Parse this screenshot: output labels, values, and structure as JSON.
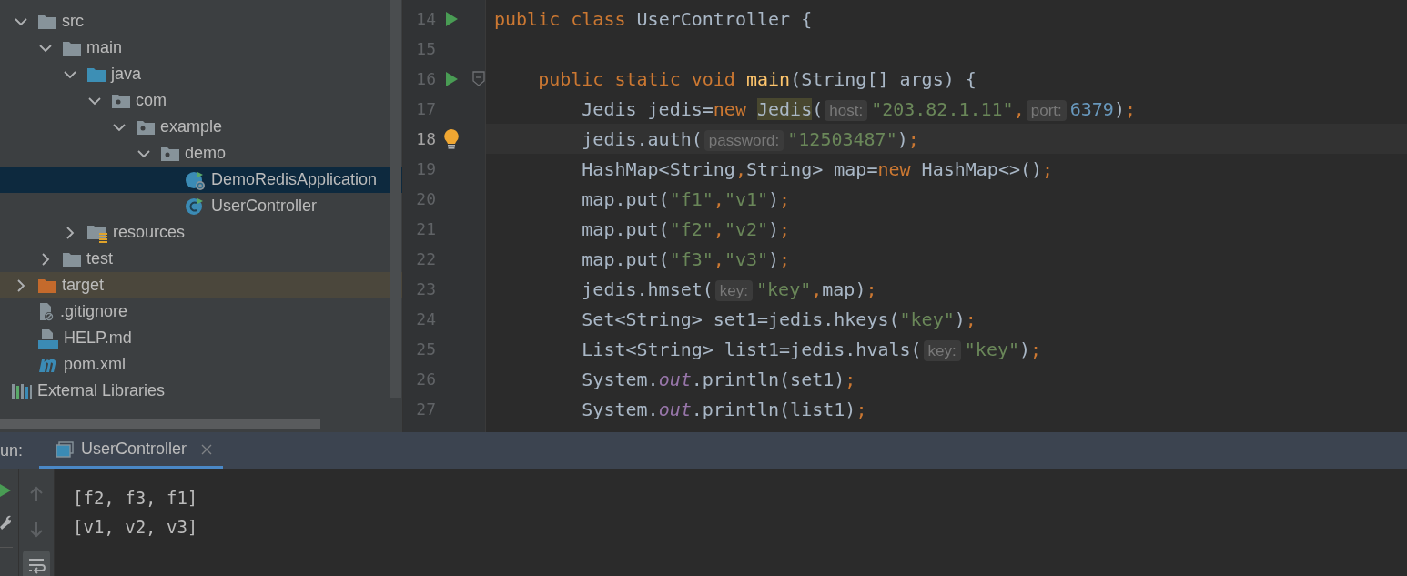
{
  "project_tree": {
    "items": [
      {
        "label": "src",
        "kind": "folder",
        "expanded": true,
        "selected": false,
        "excluded": false,
        "children": [
          {
            "label": "main",
            "kind": "folder",
            "expanded": true,
            "selected": false,
            "excluded": false,
            "children": [
              {
                "label": "java",
                "kind": "source-folder",
                "expanded": true,
                "selected": false,
                "excluded": false,
                "children": [
                  {
                    "label": "com",
                    "kind": "package",
                    "expanded": true,
                    "selected": false,
                    "excluded": false,
                    "children": [
                      {
                        "label": "example",
                        "kind": "package",
                        "expanded": true,
                        "selected": false,
                        "excluded": false,
                        "children": [
                          {
                            "label": "demo",
                            "kind": "package",
                            "expanded": true,
                            "selected": false,
                            "excluded": false,
                            "children": [
                              {
                                "label": "DemoRedisApplication",
                                "kind": "boot-class",
                                "selected": true,
                                "excluded": false
                              },
                              {
                                "label": "UserController",
                                "kind": "class",
                                "selected": false,
                                "excluded": false
                              }
                            ]
                          }
                        ]
                      }
                    ]
                  }
                ]
              },
              {
                "label": "resources",
                "kind": "resources-folder",
                "expanded": false,
                "selected": false,
                "excluded": false
              }
            ]
          },
          {
            "label": "test",
            "kind": "folder",
            "expanded": false,
            "selected": false,
            "excluded": false
          }
        ]
      },
      {
        "label": "target",
        "kind": "excluded-folder",
        "expanded": false,
        "selected": false,
        "excluded": true
      },
      {
        "label": ".gitignore",
        "kind": "ignore-file",
        "selected": false,
        "excluded": false
      },
      {
        "label": "HELP.md",
        "kind": "md-file",
        "selected": false,
        "excluded": false
      },
      {
        "label": "pom.xml",
        "kind": "maven-file",
        "selected": false,
        "excluded": false
      }
    ],
    "roots": [
      {
        "label": "External Libraries",
        "kind": "libraries",
        "selected": false
      }
    ]
  },
  "editor": {
    "lines": [
      {
        "number": "14",
        "run": true,
        "bulb": false,
        "fold": false,
        "current": false,
        "tokens": [
          {
            "kind": "kw",
            "t": "public class "
          },
          {
            "kind": "plain",
            "t": "UserController {"
          }
        ]
      },
      {
        "number": "15",
        "run": false,
        "bulb": false,
        "fold": false,
        "current": false
      },
      {
        "number": "16",
        "run": true,
        "bulb": false,
        "fold": true,
        "current": false,
        "tokens": [
          {
            "kind": "kw",
            "t": "    public static void "
          },
          {
            "kind": "fn",
            "t": "main"
          },
          {
            "kind": "plain",
            "t": "(String[] args) {"
          }
        ]
      },
      {
        "number": "17",
        "run": false,
        "bulb": false,
        "fold": false,
        "current": false,
        "tokens": [
          {
            "kind": "plain",
            "t": "        Jedis jedis="
          },
          {
            "kind": "kw",
            "t": "new "
          },
          {
            "kind": "match",
            "t": "Jedis"
          },
          {
            "kind": "plain",
            "t": "("
          },
          {
            "kind": "hint",
            "t": "host:"
          },
          {
            "kind": "str",
            "t": "\"203.82.1.11\""
          },
          {
            "kind": "punct",
            "t": ","
          },
          {
            "kind": "hint",
            "t": "port:"
          },
          {
            "kind": "num",
            "t": "6379"
          },
          {
            "kind": "plain",
            "t": ")"
          },
          {
            "kind": "punct",
            "t": ";"
          }
        ]
      },
      {
        "number": "18",
        "run": false,
        "bulb": true,
        "fold": false,
        "current": true,
        "tokens": [
          {
            "kind": "plain",
            "t": "        jedis.auth("
          },
          {
            "kind": "hint",
            "t": "password:"
          },
          {
            "kind": "str",
            "t": "\"12503487\""
          },
          {
            "kind": "plain",
            "t": ")"
          },
          {
            "kind": "punct",
            "t": ";"
          }
        ]
      },
      {
        "number": "19",
        "run": false,
        "bulb": false,
        "fold": false,
        "current": false,
        "tokens": [
          {
            "kind": "plain",
            "t": "        HashMap<String"
          },
          {
            "kind": "punct",
            "t": ","
          },
          {
            "kind": "plain",
            "t": "String> map="
          },
          {
            "kind": "kw",
            "t": "new"
          },
          {
            "kind": "plain",
            "t": " HashMap<>()"
          },
          {
            "kind": "punct",
            "t": ";"
          }
        ]
      },
      {
        "number": "20",
        "run": false,
        "bulb": false,
        "fold": false,
        "current": false,
        "tokens": [
          {
            "kind": "plain",
            "t": "        map.put("
          },
          {
            "kind": "str",
            "t": "\"f1\""
          },
          {
            "kind": "punct",
            "t": ","
          },
          {
            "kind": "str",
            "t": "\"v1\""
          },
          {
            "kind": "plain",
            "t": ")"
          },
          {
            "kind": "punct",
            "t": ";"
          }
        ]
      },
      {
        "number": "21",
        "run": false,
        "bulb": false,
        "fold": false,
        "current": false,
        "tokens": [
          {
            "kind": "plain",
            "t": "        map.put("
          },
          {
            "kind": "str",
            "t": "\"f2\""
          },
          {
            "kind": "punct",
            "t": ","
          },
          {
            "kind": "str",
            "t": "\"v2\""
          },
          {
            "kind": "plain",
            "t": ")"
          },
          {
            "kind": "punct",
            "t": ";"
          }
        ]
      },
      {
        "number": "22",
        "run": false,
        "bulb": false,
        "fold": false,
        "current": false,
        "tokens": [
          {
            "kind": "plain",
            "t": "        map.put("
          },
          {
            "kind": "str",
            "t": "\"f3\""
          },
          {
            "kind": "punct",
            "t": ","
          },
          {
            "kind": "str",
            "t": "\"v3\""
          },
          {
            "kind": "plain",
            "t": ")"
          },
          {
            "kind": "punct",
            "t": ";"
          }
        ]
      },
      {
        "number": "23",
        "run": false,
        "bulb": false,
        "fold": false,
        "current": false,
        "tokens": [
          {
            "kind": "plain",
            "t": "        jedis.hmset("
          },
          {
            "kind": "hint",
            "t": "key:"
          },
          {
            "kind": "str",
            "t": "\"key\""
          },
          {
            "kind": "punct",
            "t": ","
          },
          {
            "kind": "plain",
            "t": "map)"
          },
          {
            "kind": "punct",
            "t": ";"
          }
        ]
      },
      {
        "number": "24",
        "run": false,
        "bulb": false,
        "fold": false,
        "current": false,
        "tokens": [
          {
            "kind": "plain",
            "t": "        Set<String> set1=jedis.hkeys("
          },
          {
            "kind": "str",
            "t": "\"key\""
          },
          {
            "kind": "plain",
            "t": ")"
          },
          {
            "kind": "punct",
            "t": ";"
          }
        ]
      },
      {
        "number": "25",
        "run": false,
        "bulb": false,
        "fold": false,
        "current": false,
        "tokens": [
          {
            "kind": "plain",
            "t": "        List<String> list1=jedis.hvals("
          },
          {
            "kind": "hint",
            "t": "key:"
          },
          {
            "kind": "str",
            "t": "\"key\""
          },
          {
            "kind": "plain",
            "t": ")"
          },
          {
            "kind": "punct",
            "t": ";"
          }
        ]
      },
      {
        "number": "26",
        "run": false,
        "bulb": false,
        "fold": false,
        "current": false,
        "tokens": [
          {
            "kind": "plain",
            "t": "        System."
          },
          {
            "kind": "field",
            "t": "out"
          },
          {
            "kind": "plain",
            "t": ".println(set1)"
          },
          {
            "kind": "punct",
            "t": ";"
          }
        ]
      },
      {
        "number": "27",
        "run": false,
        "bulb": false,
        "fold": false,
        "current": false,
        "tokens": [
          {
            "kind": "plain",
            "t": "        System."
          },
          {
            "kind": "field",
            "t": "out"
          },
          {
            "kind": "plain",
            "t": ".println(list1)"
          },
          {
            "kind": "punct",
            "t": ";"
          }
        ]
      }
    ]
  },
  "run_panel": {
    "label": "un:",
    "tabs": [
      {
        "label": "UserController",
        "selected": true
      }
    ],
    "toolbar": [
      {
        "kind": "up",
        "selected": false
      },
      {
        "kind": "down",
        "selected": false
      },
      {
        "kind": "wrap",
        "selected": true
      }
    ],
    "output": [
      "[f2, f3, f1]",
      "[v1, v2, v3]"
    ]
  }
}
